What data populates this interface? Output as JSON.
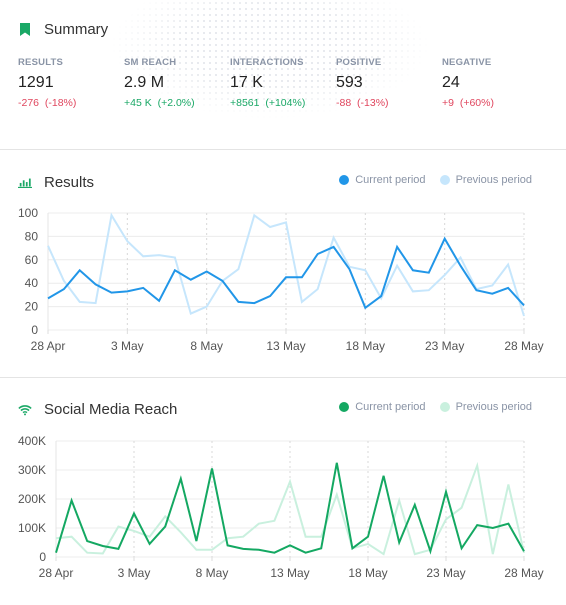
{
  "summary": {
    "title": "Summary",
    "icon": "bookmark-icon",
    "metrics": [
      {
        "label": "RESULTS",
        "value": "1291",
        "change": "-276",
        "change_pct": "(-18%)",
        "trend": "negative"
      },
      {
        "label": "SM REACH",
        "value": "2.9 M",
        "change": "+45 K",
        "change_pct": "(+2.0%)",
        "trend": "positive"
      },
      {
        "label": "INTERACTIONS",
        "value": "17 K",
        "change": "+8561",
        "change_pct": "(+104%)",
        "trend": "positive"
      },
      {
        "label": "POSITIVE",
        "value": "593",
        "change": "-88",
        "change_pct": "(-13%)",
        "trend": "negative"
      },
      {
        "label": "NEGATIVE",
        "value": "24",
        "change": "+9",
        "change_pct": "(+60%)",
        "trend": "negative"
      }
    ]
  },
  "colors": {
    "accent_green": "#1aa866",
    "negative": "#e0465e",
    "positive": "#1aa866",
    "results_current": "#2196e8",
    "results_previous": "#c6e6fc",
    "reach_current": "#14a862",
    "reach_previous": "#c9f0de"
  },
  "chart_data": [
    {
      "type": "line",
      "title": "Results",
      "icon": "bar-chart-icon",
      "xlabel": "",
      "ylabel": "",
      "ylim": [
        0,
        100
      ],
      "yticks": [
        "0",
        "20",
        "40",
        "60",
        "80",
        "100"
      ],
      "ytick_values": [
        0,
        20,
        40,
        60,
        80,
        100
      ],
      "xtick_labels": [
        "28 Apr",
        "3 May",
        "8 May",
        "13 May",
        "18 May",
        "23 May",
        "28 May"
      ],
      "xtick_index": [
        0,
        5,
        10,
        15,
        20,
        25,
        30
      ],
      "grid": true,
      "legend": "top-right",
      "series": [
        {
          "name": "Current period",
          "values": [
            27,
            35,
            51,
            39,
            32,
            33,
            36,
            25,
            51,
            43,
            50,
            42,
            24,
            23,
            29,
            45,
            45,
            65,
            71,
            52,
            19,
            29,
            71,
            51,
            49,
            78,
            55,
            34,
            31,
            36,
            21
          ]
        },
        {
          "name": "Previous period",
          "values": [
            72,
            42,
            24,
            23,
            98,
            76,
            63,
            64,
            62,
            14,
            20,
            42,
            52,
            98,
            88,
            92,
            24,
            35,
            79,
            54,
            51,
            27,
            55,
            33,
            34,
            47,
            62,
            35,
            38,
            56,
            12
          ]
        }
      ]
    },
    {
      "type": "line",
      "title": "Social Media Reach",
      "icon": "wifi-icon",
      "xlabel": "",
      "ylabel": "",
      "ylim": [
        0,
        400000
      ],
      "yticks": [
        "0",
        "100K",
        "200K",
        "300K",
        "400K"
      ],
      "ytick_values": [
        0,
        100000,
        200000,
        300000,
        400000
      ],
      "xtick_labels": [
        "28 Apr",
        "3 May",
        "8 May",
        "13 May",
        "18 May",
        "23 May",
        "28 May"
      ],
      "xtick_index": [
        0,
        5,
        10,
        15,
        20,
        25,
        30
      ],
      "grid": true,
      "legend": "top-right",
      "series": [
        {
          "name": "Current period",
          "values": [
            15000,
            195000,
            55000,
            38000,
            28000,
            150000,
            45000,
            105000,
            270000,
            55000,
            305000,
            40000,
            28000,
            25000,
            15000,
            40000,
            15000,
            30000,
            325000,
            30000,
            70000,
            280000,
            50000,
            180000,
            20000,
            225000,
            30000,
            110000,
            100000,
            115000,
            20000
          ]
        },
        {
          "name": "Previous period",
          "values": [
            65000,
            70000,
            15000,
            12000,
            105000,
            90000,
            70000,
            140000,
            85000,
            25000,
            25000,
            65000,
            70000,
            115000,
            125000,
            260000,
            70000,
            70000,
            215000,
            30000,
            45000,
            10000,
            195000,
            10000,
            25000,
            130000,
            170000,
            315000,
            10000,
            250000,
            15000
          ]
        }
      ]
    }
  ]
}
